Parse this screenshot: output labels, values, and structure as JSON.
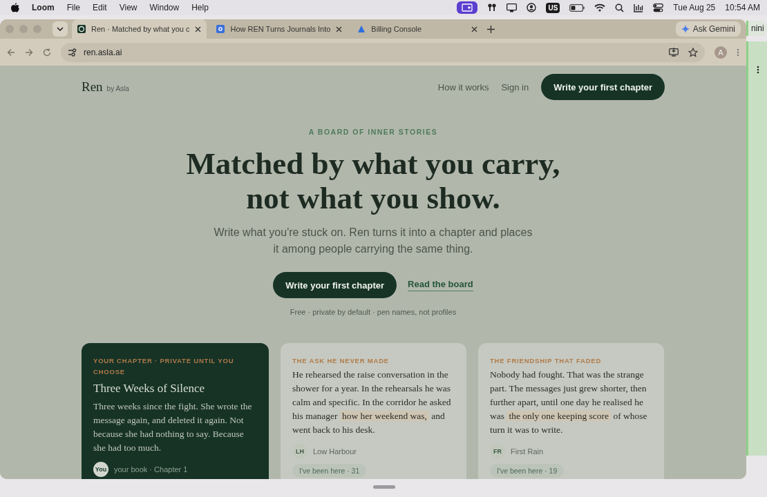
{
  "menubar": {
    "app": "Loom",
    "menus": [
      "File",
      "Edit",
      "View",
      "Window",
      "Help"
    ],
    "keyboard": "US",
    "date": "Tue Aug 25",
    "time": "10:54 AM"
  },
  "browser": {
    "tabs": [
      {
        "title": "Ren · Matched by what you c",
        "selected": true
      },
      {
        "title": "How REN Turns Journals Into",
        "selected": false
      },
      {
        "title": "Billing Console",
        "selected": false
      }
    ],
    "assistant": "Ask Gemini",
    "url": "ren.asla.ai",
    "avatar": "A"
  },
  "other_window": {
    "text": "nini"
  },
  "site": {
    "brand": "Ren",
    "brand_sub": "by Asla",
    "nav": [
      "How it works",
      "Sign in"
    ],
    "cta": "Write your first chapter",
    "eyebrow": "A BOARD OF INNER STORIES",
    "headline": [
      "Matched by what you carry,",
      "not what you show."
    ],
    "lead": "Write what you're stuck on. Ren turns it into a chapter and places it among people carrying the same thing.",
    "primary": "Write your first chapter",
    "secondary": "Read the board",
    "note": "Free · private by default · pen names, not profiles"
  },
  "cards": [
    {
      "kind": "own",
      "label": "YOUR CHAPTER · PRIVATE UNTIL YOU CHOOSE",
      "title": "Three Weeks of Silence",
      "body": [
        {
          "text": "Three weeks since the fight. She wrote the message again, and deleted it again. Not because she had nothing to say. Because she had too much.",
          "highlight": false
        }
      ],
      "initials": "You",
      "author": "your book · Chapter 1"
    },
    {
      "kind": "shared",
      "label": "THE ASK HE NEVER MADE",
      "body": [
        {
          "text": "He rehearsed the raise conversation in the shower for a year. In the rehearsals he was calm and specific. In the corridor he asked his manager ",
          "highlight": false
        },
        {
          "text": "how her weekend was,",
          "highlight": true
        },
        {
          "text": " and went back to his desk.",
          "highlight": false
        }
      ],
      "initials": "LH",
      "author": "Low Harbour",
      "reaction": "I've been here · 31"
    },
    {
      "kind": "shared",
      "label": "THE FRIENDSHIP THAT FADED",
      "body": [
        {
          "text": "Nobody had fought. That was the strange part. The messages just grew shorter, then further apart, until one day he realised he was ",
          "highlight": false
        },
        {
          "text": "the only one keeping score",
          "highlight": true
        },
        {
          "text": " of whose turn it was to write.",
          "highlight": false
        }
      ],
      "initials": "FR",
      "author": "First Rain",
      "reaction": "I've been here · 19"
    }
  ]
}
